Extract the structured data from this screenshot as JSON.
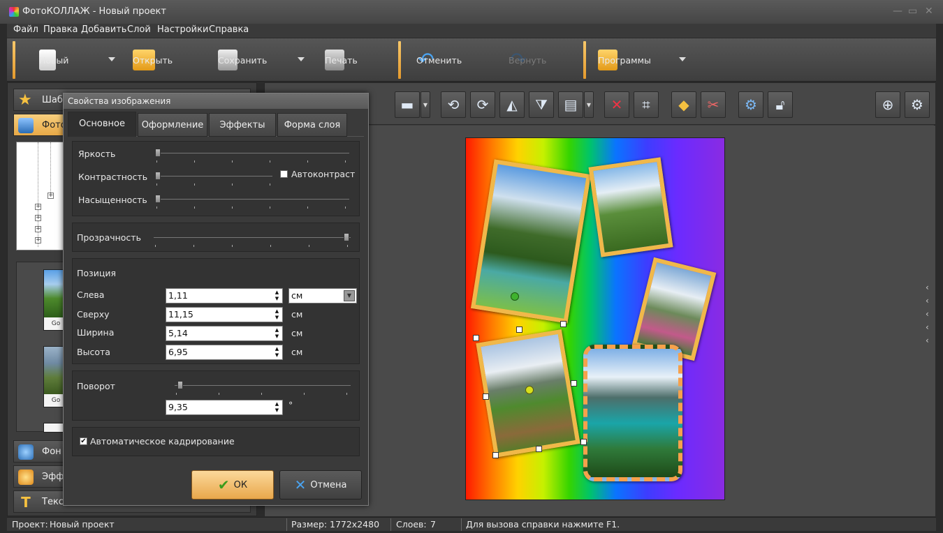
{
  "window": {
    "title": "ФотоКОЛЛАЖ - Новый проект"
  },
  "menu": [
    "Файл",
    "Правка",
    "Добавить",
    "Слой",
    "Настройки",
    "Справка"
  ],
  "toolbar": {
    "new": "Новый",
    "open": "Открыть",
    "save": "Сохранить",
    "print": "Печать",
    "undo": "Отменить",
    "redo": "Вернуть",
    "programs": "Программы"
  },
  "left_panel": {
    "templates": "Шаблоны",
    "photos": "Фотографии",
    "background": "Фон",
    "effects": "Эффекты",
    "text": "Текст",
    "thumb_captions": [
      "Go",
      "Go"
    ]
  },
  "dialog": {
    "title": "Свойства изображения",
    "tabs": [
      "Основное",
      "Оформление",
      "Эффекты",
      "Форма слоя"
    ],
    "brightness": "Яркость",
    "contrast": "Контрастность",
    "autocontrast": "Автоконтраст",
    "saturation": "Насыщенность",
    "transparency": "Прозрачность",
    "position_title": "Позиция",
    "left_label": "Слева",
    "top_label": "Сверху",
    "width_label": "Ширина",
    "height_label": "Высота",
    "left_value": "1,11",
    "top_value": "11,15",
    "width_value": "5,14",
    "height_value": "6,95",
    "unit_select": "см",
    "unit": "см",
    "rotation_title": "Поворот",
    "rotation_value": "9,35",
    "degree": "°",
    "autocrop": "Автоматическое кадрирование",
    "ok": "ОК",
    "cancel": "Отмена",
    "sliders": {
      "brightness": 0,
      "contrast": 0,
      "saturation": 0,
      "transparency": 1.0,
      "rotation": 0.13
    }
  },
  "status": {
    "project_label": "Проект:",
    "project_name": "Новый проект",
    "size_label": "Размер:",
    "size_value": "1772x2480",
    "layers_label": "Слоев:",
    "layers_value": "7",
    "hint": "Для вызова справки нажмите F1."
  },
  "colors": {
    "accent": "#f0b84a",
    "orange_sep": "#e59a2d"
  }
}
